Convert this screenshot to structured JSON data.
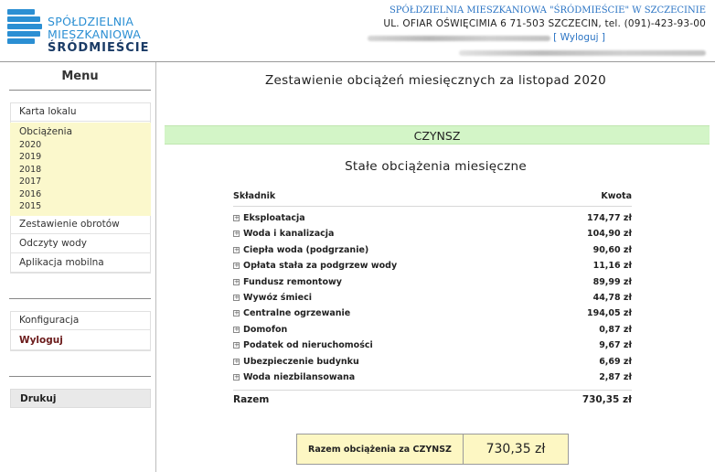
{
  "header": {
    "logo": {
      "line1": "SPÓŁDZIELNIA",
      "line2": "MIESZKANIOWA",
      "line3": "ŚRÓDMIEŚCIE"
    },
    "cooperative_name": "SPÓŁDZIELNIA MIESZKANIOWA \"ŚRÓDMIEŚCIE\" W SZCZECINIE",
    "address": "UL. OFIAR OŚWIĘCIMIA 6 71-503 SZCZECIN, tel. (091)-423-93-00",
    "logout_link": "[ Wyloguj ]"
  },
  "sidebar": {
    "title": "Menu",
    "items": [
      {
        "label": "Karta lokalu"
      },
      {
        "label": "Obciążenia",
        "active": true,
        "years": [
          "2020",
          "2019",
          "2018",
          "2017",
          "2016",
          "2015"
        ]
      },
      {
        "label": "Zestawienie obrotów"
      },
      {
        "label": "Odczyty wody"
      },
      {
        "label": "Aplikacja mobilna"
      }
    ],
    "config_items": [
      {
        "label": "Konfiguracja"
      },
      {
        "label": "Wyloguj"
      }
    ],
    "print_label": "Drukuj"
  },
  "main": {
    "title": "Zestawienie obciążeń miesięcznych za listopad 2020",
    "section": "CZYNSZ",
    "subtitle": "Stałe obciążenia miesięczne",
    "table": {
      "col_component": "Składnik",
      "col_amount": "Kwota",
      "rows": [
        {
          "name": "Eksploatacja",
          "amount": "174,77 zł"
        },
        {
          "name": "Woda i kanalizacja",
          "amount": "104,90 zł"
        },
        {
          "name": "Ciepła woda (podgrzanie)",
          "amount": "90,60 zł"
        },
        {
          "name": "Opłata stała za podgrzew wody",
          "amount": "11,16 zł"
        },
        {
          "name": "Fundusz remontowy",
          "amount": "89,99 zł"
        },
        {
          "name": "Wywóz śmieci",
          "amount": "44,78 zł"
        },
        {
          "name": "Centralne ogrzewanie",
          "amount": "194,05 zł"
        },
        {
          "name": "Domofon",
          "amount": "0,87 zł"
        },
        {
          "name": "Podatek od nieruchomości",
          "amount": "9,67 zł"
        },
        {
          "name": "Ubezpieczenie budynku",
          "amount": "6,69 zł"
        },
        {
          "name": "Woda niezbilansowana",
          "amount": "2,87 zł"
        }
      ],
      "total_label": "Razem",
      "total_amount": "730,35 zł"
    },
    "summary": {
      "label": "Razem obciążenia za CZYNSZ",
      "amount": "730,35 zł"
    }
  },
  "colors": {
    "brand_blue": "#2b8fd3",
    "section_green": "#d3f5c7",
    "active_menu_yellow": "#fbf8cc",
    "summary_yellow": "#fdf7c3"
  }
}
